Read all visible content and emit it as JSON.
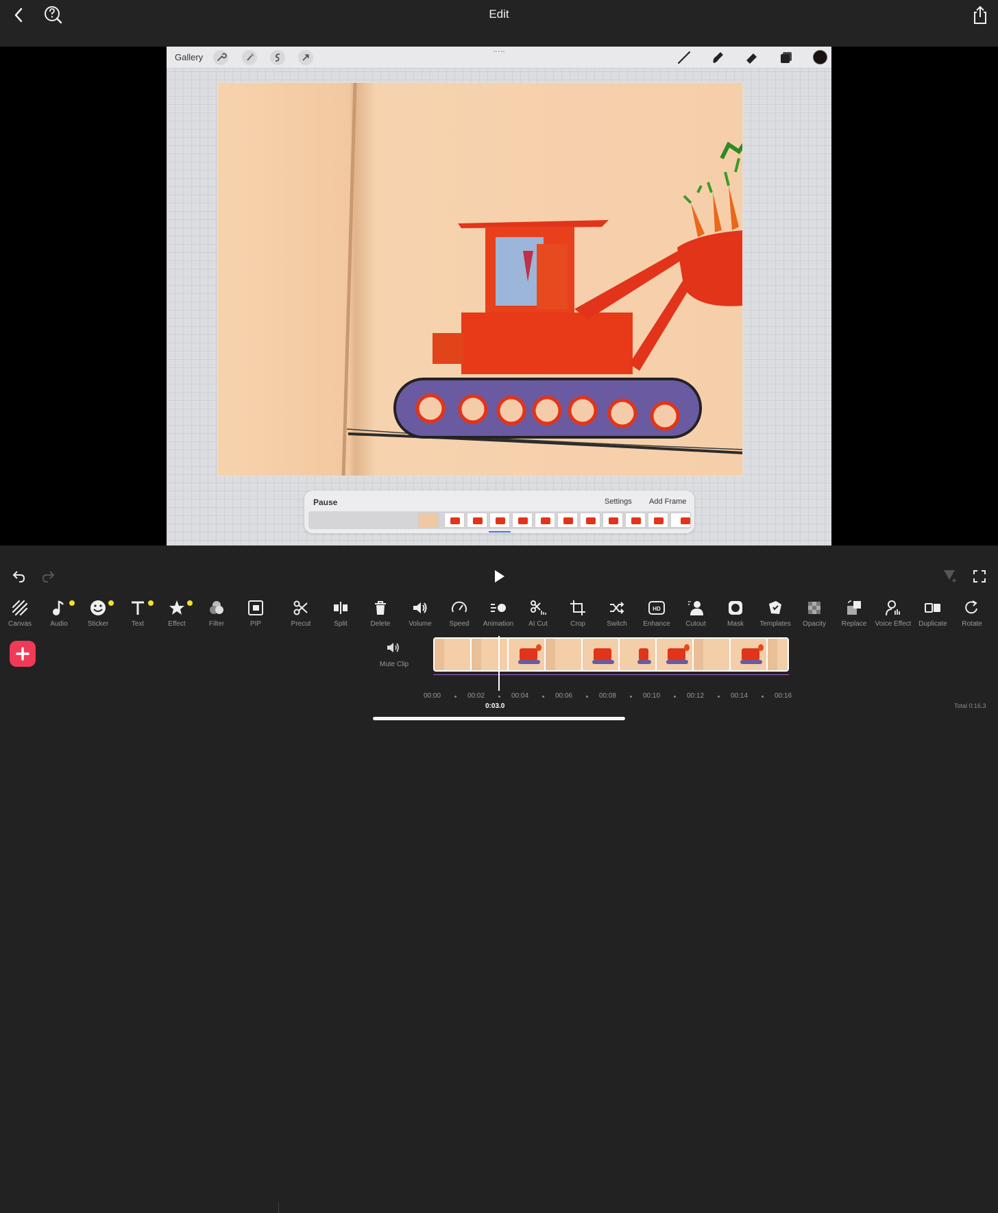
{
  "header": {
    "title": "Edit"
  },
  "procreate": {
    "gallery_label": "Gallery",
    "tools_left": [
      "wrench-icon",
      "magic-wand-icon",
      "selection-icon",
      "transform-icon"
    ],
    "tools_right": [
      "brush-icon",
      "smudge-icon",
      "eraser-icon",
      "layers-icon"
    ],
    "current_color": "#1a1010"
  },
  "animation_assist": {
    "pause_label": "Pause",
    "settings_label": "Settings",
    "add_frame_label": "Add Frame",
    "frame_count": 12
  },
  "toolbar": {
    "tools": [
      {
        "label": "Canvas",
        "icon": "canvas-icon",
        "dot": false
      },
      {
        "label": "Audio",
        "icon": "music-note-icon",
        "dot": true
      },
      {
        "label": "Sticker",
        "icon": "smiley-icon",
        "dot": true
      },
      {
        "label": "Text",
        "icon": "text-icon",
        "dot": true
      },
      {
        "label": "Effect",
        "icon": "star-icon",
        "dot": true
      },
      {
        "label": "Filter",
        "icon": "filter-circles-icon",
        "dot": false
      },
      {
        "label": "PIP",
        "icon": "pip-icon",
        "dot": false
      },
      {
        "label": "Precut",
        "icon": "scissors-icon",
        "dot": false
      },
      {
        "label": "Split",
        "icon": "split-icon",
        "dot": false
      },
      {
        "label": "Delete",
        "icon": "trash-icon",
        "dot": false
      },
      {
        "label": "Volume",
        "icon": "speaker-icon",
        "dot": false
      },
      {
        "label": "Speed",
        "icon": "speedometer-icon",
        "dot": false
      },
      {
        "label": "Animation",
        "icon": "animation-icon",
        "dot": false
      },
      {
        "label": "AI Cut",
        "icon": "ai-cut-icon",
        "dot": false
      },
      {
        "label": "Crop",
        "icon": "crop-icon",
        "dot": false
      },
      {
        "label": "Switch",
        "icon": "shuffle-icon",
        "dot": false
      },
      {
        "label": "Enhance",
        "icon": "hd-icon",
        "dot": false
      },
      {
        "label": "Cutout",
        "icon": "cutout-person-icon",
        "dot": false
      },
      {
        "label": "Mask",
        "icon": "mask-icon",
        "dot": false
      },
      {
        "label": "Templates",
        "icon": "templates-icon",
        "dot": false
      },
      {
        "label": "Opacity",
        "icon": "opacity-checker-icon",
        "dot": false
      },
      {
        "label": "Replace",
        "icon": "replace-icon",
        "dot": false
      },
      {
        "label": "Voice Effect",
        "icon": "voice-effect-icon",
        "dot": false
      },
      {
        "label": "Duplicate",
        "icon": "duplicate-icon",
        "dot": false
      },
      {
        "label": "Rotate",
        "icon": "rotate-icon",
        "dot": false
      }
    ]
  },
  "timeline": {
    "mute_label": "Mute Clip",
    "ticks": [
      "00:00",
      "00:02",
      "00:04",
      "00:06",
      "00:08",
      "00:10",
      "00:12",
      "00:14",
      "00:16"
    ],
    "current_time": "0:03.0",
    "total": "Total 0:16.3",
    "clip_frames": 10
  },
  "colors": {
    "accent_add": "#f03a57",
    "badge_dot": "#f5e12a",
    "playhead": "#ffffff",
    "audio_line": "#a45fd6"
  }
}
